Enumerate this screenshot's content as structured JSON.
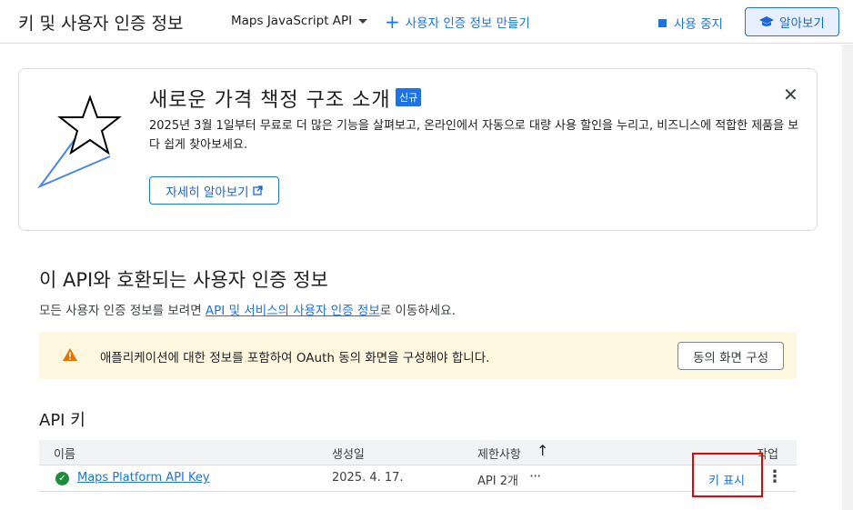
{
  "header": {
    "title": "키 및 사용자 인증 정보",
    "api_select": "Maps JavaScript API",
    "create_credentials": "사용자 인증 정보 만들기",
    "stop_using": "사용 중지",
    "learn_more": "알아보기"
  },
  "promo": {
    "title": "새로운 가격 책정 구조 소개",
    "badge": "신규",
    "body": "2025년 3월 1일부터 무료로 더 많은 기능을 살펴보고, 온라인에서 자동으로 대량 사용 할인을 누리고, 비즈니스에 적합한 제품을 보다 쉽게 찾아보세요.",
    "learn_more": "자세히 알아보기",
    "close": "✕"
  },
  "section": {
    "title": "이 API와 호환되는 사용자 인증 정보",
    "desc_prefix": "모든 사용자 인증 정보를 보려면 ",
    "desc_link": "API 및 서비스의 사용자 인증 정보",
    "desc_suffix": "로 이동하세요."
  },
  "warning": {
    "text": "애플리케이션에 대한 정보를 포함하여 OAuth 동의 화면을 구성해야 합니다.",
    "button": "동의 화면 구성"
  },
  "api_keys": {
    "title": "API 키",
    "columns": [
      "이름",
      "생성일",
      "제한사항",
      "작업"
    ],
    "rows": [
      {
        "name": "Maps Platform API Key",
        "created": "2025. 4. 17.",
        "restrictions": "API 2개",
        "action": "키 표시"
      }
    ]
  },
  "colors": {
    "accent": "#1a73e8",
    "warning_bg": "#fef7e0",
    "highlight": "#ee0000",
    "success": "#1e8e3e"
  }
}
